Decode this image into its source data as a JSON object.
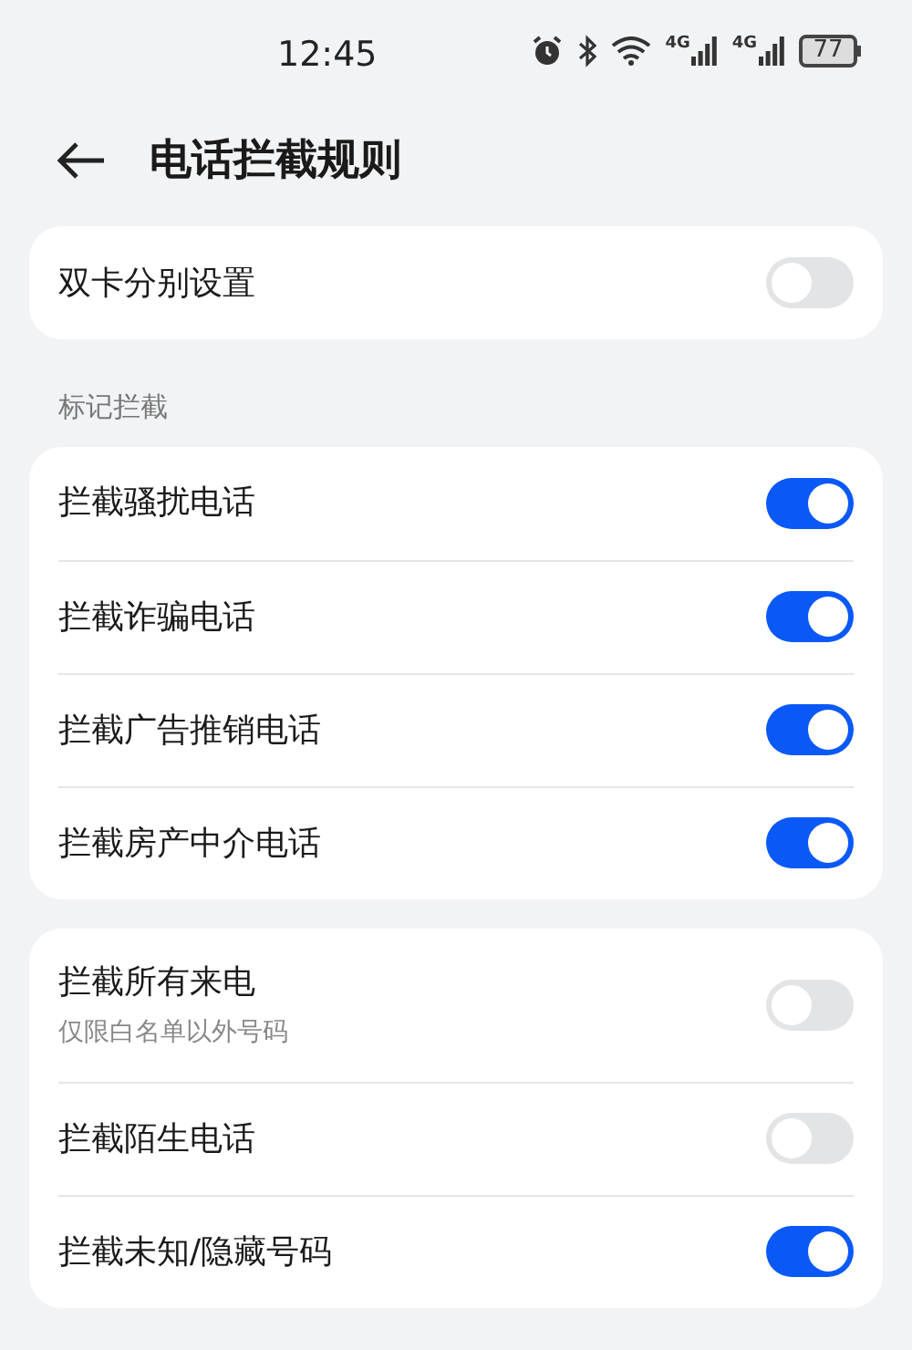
{
  "status_bar": {
    "time": "12:45",
    "network_1": "4G",
    "network_2": "4G",
    "battery": "77"
  },
  "header": {
    "title": "电话拦截规则"
  },
  "groups": [
    {
      "items": [
        {
          "label": "双卡分别设置",
          "on": false
        }
      ]
    },
    {
      "heading": "标记拦截",
      "items": [
        {
          "label": "拦截骚扰电话",
          "on": true
        },
        {
          "label": "拦截诈骗电话",
          "on": true
        },
        {
          "label": "拦截广告推销电话",
          "on": true
        },
        {
          "label": "拦截房产中介电话",
          "on": true
        }
      ]
    },
    {
      "items": [
        {
          "label": "拦截所有来电",
          "sublabel": "仅限白名单以外号码",
          "on": false
        },
        {
          "label": "拦截陌生电话",
          "on": false
        },
        {
          "label": "拦截未知/隐藏号码",
          "on": true
        }
      ]
    }
  ]
}
